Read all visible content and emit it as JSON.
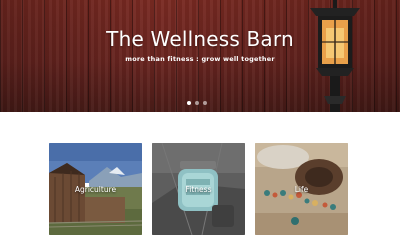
{
  "hero": {
    "title": "The Wellness Barn",
    "subtitle": "more than fitness : grow well together",
    "slide_count": 3,
    "active_slide": 1
  },
  "cards": [
    {
      "label": "Agriculture",
      "icon": "barn-photo"
    },
    {
      "label": "Fitness",
      "icon": "jar-photo"
    },
    {
      "label": "Life",
      "icon": "jewelry-photo"
    }
  ],
  "colors": {
    "hero_wood": "#6a2520",
    "label_text": "#ffffff"
  }
}
